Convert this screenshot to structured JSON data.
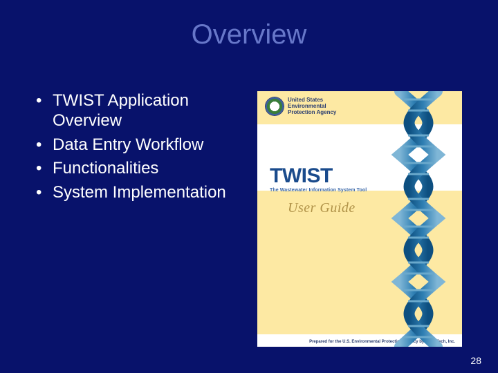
{
  "title": "Overview",
  "bullets": [
    "TWIST Application Overview",
    "Data Entry Workflow",
    "Functionalities",
    "System Implementation"
  ],
  "cover": {
    "epa_line1": "United States",
    "epa_line2": "Environmental",
    "epa_line3": "Protection Agency",
    "logo": "TWIST",
    "subtitle": "The Wastewater Information System Tool",
    "user_guide": "User Guide",
    "footer": "Prepared for the U.S. Environmental Protection Agency by Tetra Tech, Inc."
  },
  "page_number": "28"
}
